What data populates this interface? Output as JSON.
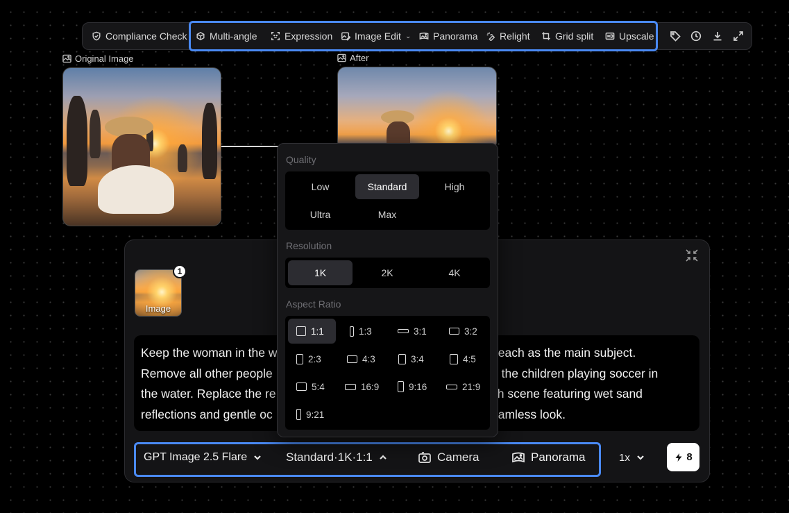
{
  "toolbar": {
    "compliance": "Compliance Check",
    "multi_angle": "Multi-angle",
    "expression": "Expression",
    "image_edit": "Image Edit",
    "panorama": "Panorama",
    "relight": "Relight",
    "grid_split": "Grid split",
    "upscale": "Upscale",
    "icons": [
      "tag-icon",
      "history-icon",
      "download-icon",
      "expand-icon"
    ]
  },
  "nodes": {
    "original_label": "Original Image",
    "after_label": "After"
  },
  "panel": {
    "thumb_label": "Image",
    "thumb_badge": "1",
    "prompt_lines": [
      "Keep the woman in the w",
      "beach as the main subject.",
      "Remove all other people",
      "d the children playing soccer in",
      "the water. Replace the re",
      "ch scene featuring wet sand",
      "reflections and gentle oc",
      "eamless look."
    ]
  },
  "bottom_bar": {
    "model": "GPT Image 2.5 Flare",
    "settings": "Standard·1K·1:1",
    "camera": "Camera",
    "panorama": "Panorama",
    "multiplier": "1x",
    "credits": "8"
  },
  "popover": {
    "quality_title": "Quality",
    "quality_options": [
      "Low",
      "Standard",
      "High",
      "Ultra",
      "Max"
    ],
    "quality_selected": "Standard",
    "resolution_title": "Resolution",
    "resolution_options": [
      "1K",
      "2K",
      "4K"
    ],
    "resolution_selected": "1K",
    "aspect_title": "Aspect Ratio",
    "aspect_options": [
      "1:1",
      "1:3",
      "3:1",
      "3:2",
      "2:3",
      "4:3",
      "3:4",
      "4:5",
      "5:4",
      "16:9",
      "9:16",
      "21:9",
      "9:21"
    ],
    "aspect_selected": "1:1"
  },
  "colors": {
    "highlight": "#4a8af4",
    "background": "#000000",
    "panel": "#141416"
  }
}
